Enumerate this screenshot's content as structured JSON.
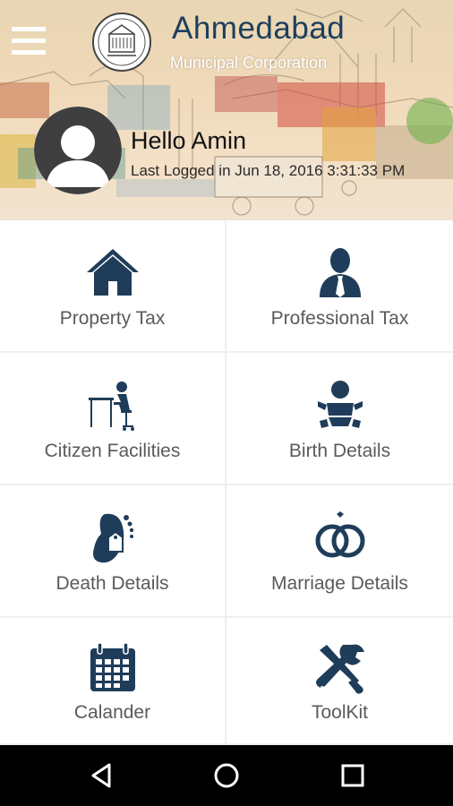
{
  "header": {
    "menu_icon": "hamburger-menu-icon",
    "logo_icon": "amc-emblem-logo",
    "title": "Ahmedabad",
    "subtitle": "Municipal Corporation"
  },
  "user": {
    "avatar_icon": "user-avatar-icon",
    "greeting": "Hello Amin",
    "last_logged": "Last Logged in Jun 18, 2016 3:31:33 PM"
  },
  "menu": {
    "items": [
      {
        "label": "Property Tax",
        "icon": "house-icon"
      },
      {
        "label": "Professional Tax",
        "icon": "businessman-icon"
      },
      {
        "label": "Citizen Facilities",
        "icon": "person-at-desk-icon"
      },
      {
        "label": "Birth Details",
        "icon": "baby-icon"
      },
      {
        "label": "Death Details",
        "icon": "foot-tag-icon"
      },
      {
        "label": "Marriage Details",
        "icon": "rings-icon"
      },
      {
        "label": "Calander",
        "icon": "calendar-icon"
      },
      {
        "label": "ToolKit",
        "icon": "tools-icon"
      }
    ]
  },
  "navbar": {
    "back_icon": "back-triangle-icon",
    "home_icon": "home-circle-icon",
    "recents_icon": "recents-square-icon"
  },
  "colors": {
    "icon_color": "#1f3d5a",
    "title_color": "#1d3e5c",
    "label_color": "#5a5a5a"
  }
}
